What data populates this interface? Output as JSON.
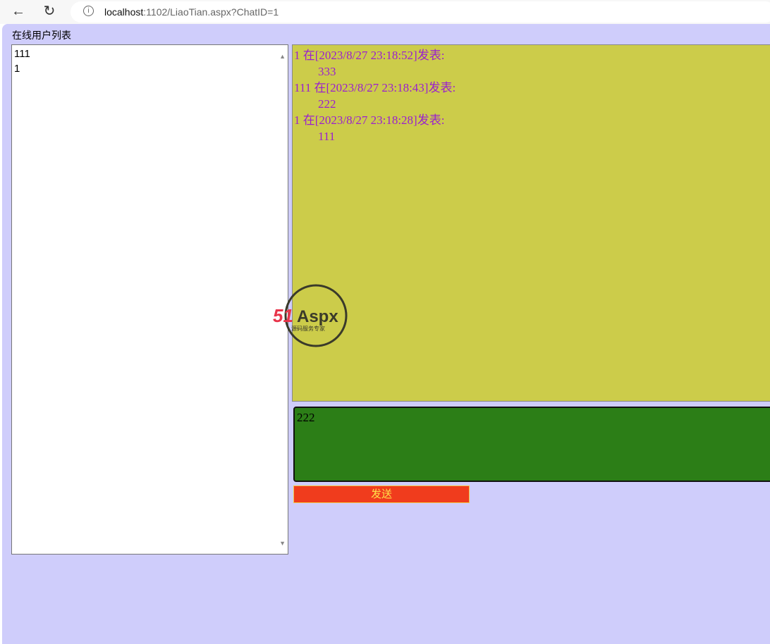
{
  "browser": {
    "url_host": "localhost",
    "url_rest": ":1102/LiaoTian.aspx?ChatID=1"
  },
  "sidebar": {
    "title": "在线用户列表",
    "users": [
      "111",
      "1"
    ]
  },
  "messages": [
    {
      "header": "1 在[2023/8/27 23:18:52]发表:",
      "body": "333"
    },
    {
      "header": "111 在[2023/8/27 23:18:43]发表:",
      "body": "222"
    },
    {
      "header": "1 在[2023/8/27 23:18:28]发表:",
      "body": "111"
    }
  ],
  "composer": {
    "value": "222",
    "send_label": "发送"
  },
  "watermark": {
    "brand": "51Aspx",
    "tagline": "源码服务专家"
  },
  "colors": {
    "page": "#cfcdfb",
    "messages_bg": "#cccc4a",
    "message_text": "#9a1fcf",
    "input_bg": "#2c7e17",
    "send_bg": "#f03c1d",
    "send_text": "#ffe24a"
  }
}
